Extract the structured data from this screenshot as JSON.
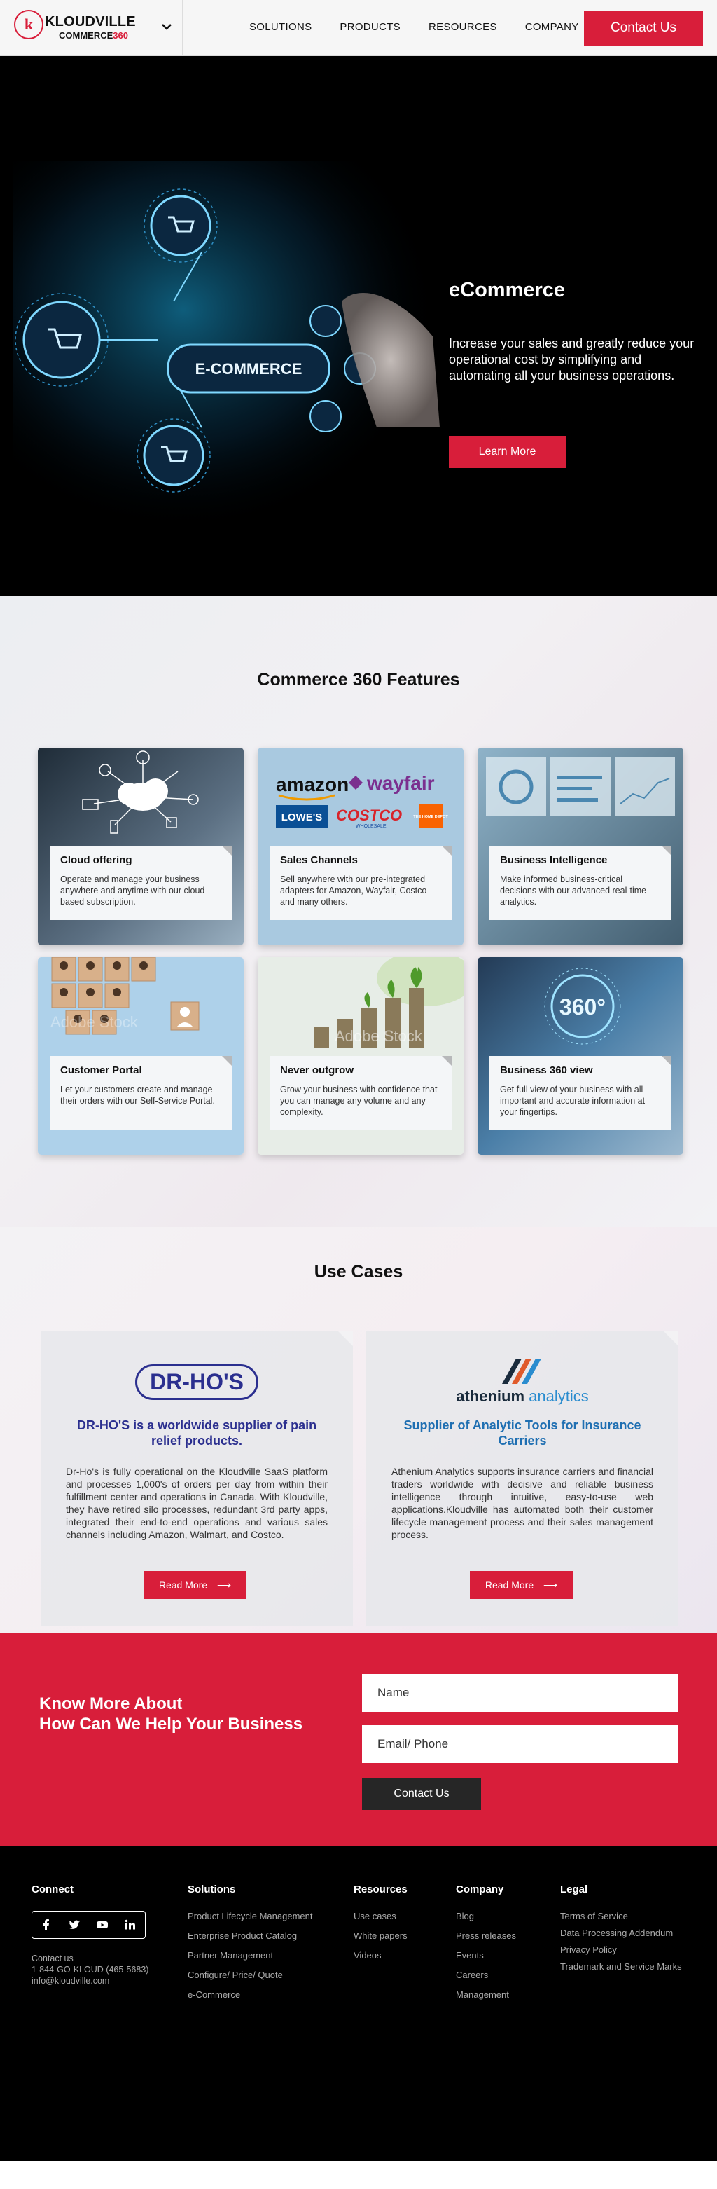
{
  "header": {
    "logo_mark": "k",
    "logo_line1": "KLOUDVILLE",
    "logo_line2a": "COMMERCE",
    "logo_line2b": "360",
    "nav": [
      "SOLUTIONS",
      "PRODUCTS",
      "RESOURCES",
      "COMPANY"
    ],
    "contact_label": "Contact Us"
  },
  "hero": {
    "badge": "E-COMMERCE",
    "title": "eCommerce",
    "description": "Increase your sales and greatly reduce your operational cost by simplifying and automating all your business operations.",
    "button": "Learn More"
  },
  "features": {
    "title": "Commerce 360 Features",
    "cards": [
      {
        "title": "Cloud offering",
        "text": "Operate and manage your business anywhere and anytime with our cloud-based subscription."
      },
      {
        "title": "Sales Channels",
        "text": "Sell anywhere with our pre-integrated adapters for Amazon, Wayfair, Costco and many others."
      },
      {
        "title": "Business Intelligence",
        "text": "Make informed business-critical decisions with our advanced real-time analytics."
      },
      {
        "title": "Customer Portal",
        "text": "Let your customers create and manage their orders with our Self-Service Portal."
      },
      {
        "title": "Never outgrow",
        "text": "Grow your business with confidence that you can manage any volume and any complexity."
      },
      {
        "title": "Business 360 view",
        "text": "Get full view of your business with all important and accurate information at your fingertips."
      }
    ],
    "brands": {
      "amazon": "amazon",
      "wayfair": "wayfair",
      "lowes": "LOWE'S",
      "costco": "COSTCO",
      "costco_sub": "WHOLESALE",
      "homedepot": "THE HOME DEPOT"
    },
    "overlay_360": "360°",
    "watermark": "Adobe Stock"
  },
  "usecases": {
    "title": "Use Cases",
    "items": [
      {
        "logo": "DR-HO'S",
        "headline": "DR-HO'S is a worldwide supplier of pain relief products.",
        "body": "Dr-Ho's is fully operational on the Kloudville SaaS platform and processes 1,000's of orders per day from within their fulfillment center and operations in Canada. With  Kloudville, they have retired silo processes, redundant 3rd party apps, integrated their end-to-end operations and various sales channels including Amazon, Walmart, and Costco.",
        "button": "Read More"
      },
      {
        "logo_a": "athenium",
        "logo_b": " analytics",
        "headline": "Supplier of Analytic Tools for Insurance Carriers",
        "body": "Athenium Analytics supports insurance carriers and financial traders worldwide with decisive and reliable business intelligence through intuitive, easy-to-use web applications.Kloudville has automated both their customer lifecycle management process and their sales management process.",
        "button": "Read More"
      }
    ]
  },
  "help": {
    "line1": "Know More About",
    "line2": "How Can We Help Your Business",
    "name_placeholder": "Name",
    "email_placeholder": "Email/ Phone",
    "button": "Contact Us"
  },
  "footer": {
    "connect": {
      "title": "Connect",
      "contact_label": "Contact us",
      "phone": "1-844-GO-KLOUD (465-5683)",
      "email": "info@kloudville.com"
    },
    "solutions": {
      "title": "Solutions",
      "links": [
        "Product Lifecycle Management",
        "Enterprise Product Catalog",
        "Partner Management",
        "Configure/ Price/ Quote",
        "e-Commerce"
      ]
    },
    "resources": {
      "title": "Resources",
      "links": [
        "Use cases",
        "White papers",
        "Videos"
      ]
    },
    "company": {
      "title": "Company",
      "links": [
        "Blog",
        "Press releases",
        "Events",
        "Careers",
        "Management"
      ]
    },
    "legal": {
      "title": "Legal",
      "links": [
        "Terms of Service",
        "Data Processing Addendum",
        "Privacy Policy",
        "Trademark and Service Marks"
      ]
    }
  },
  "colors": {
    "brand_red": "#d81e3a",
    "navy": "#2b2f8f",
    "teal_blue": "#1f6fb2",
    "footer_bg": "#000000"
  }
}
